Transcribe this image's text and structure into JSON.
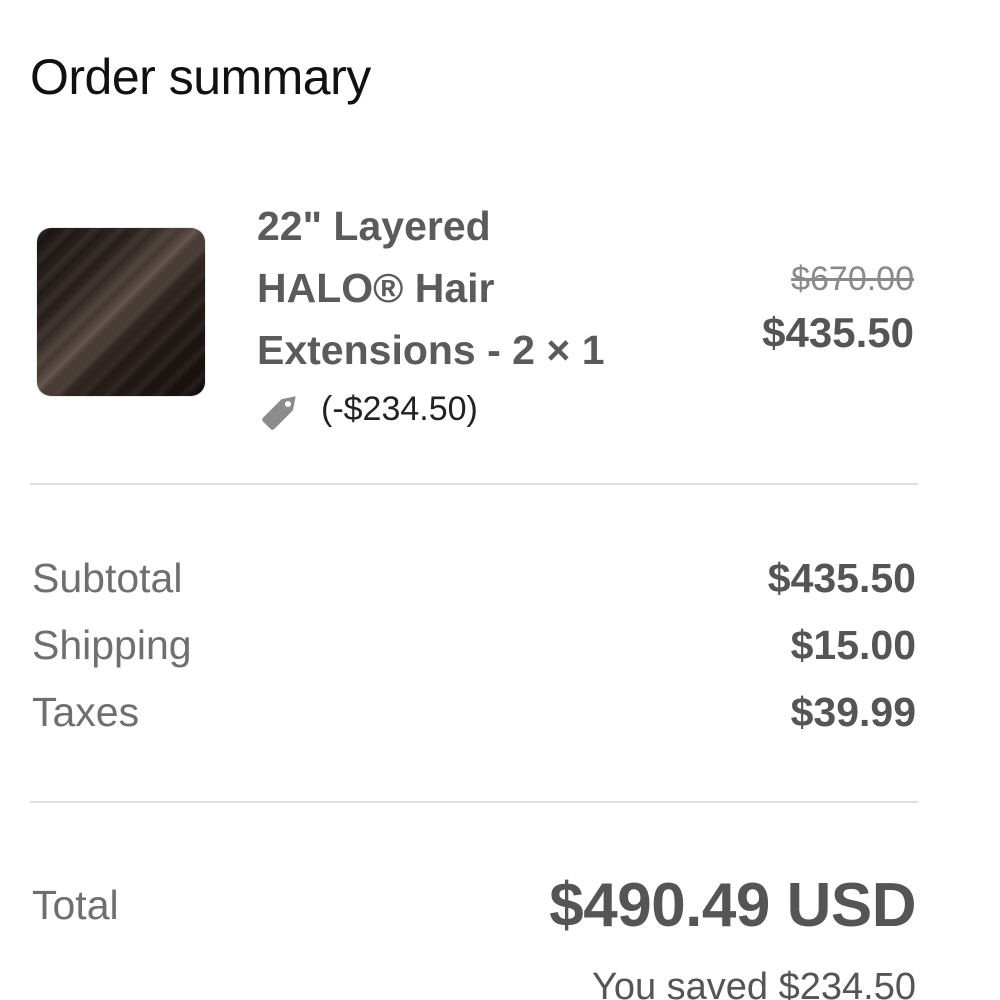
{
  "summary": {
    "title": "Order summary"
  },
  "item": {
    "name_line1": "22\" Layered",
    "name_line2": "HALO® Hair",
    "name_line3": "Extensions - 2 × 1",
    "discount": "(-$234.50)",
    "original_price": "$670.00",
    "price": "$435.50",
    "icons": {
      "thumbnail": "hair-extension-thumbnail",
      "discount": "price-tag-icon"
    }
  },
  "totals": {
    "subtotal_label": "Subtotal",
    "subtotal_value": "$435.50",
    "shipping_label": "Shipping",
    "shipping_value": "$15.00",
    "taxes_label": "Taxes",
    "taxes_value": "$39.99",
    "total_label": "Total",
    "total_value": "$490.49 USD",
    "savings_text": "You saved $234.50"
  },
  "colors": {
    "text_primary": "#111111",
    "text_secondary": "#555555",
    "text_muted": "#8a8a8a",
    "divider": "#dedede"
  }
}
